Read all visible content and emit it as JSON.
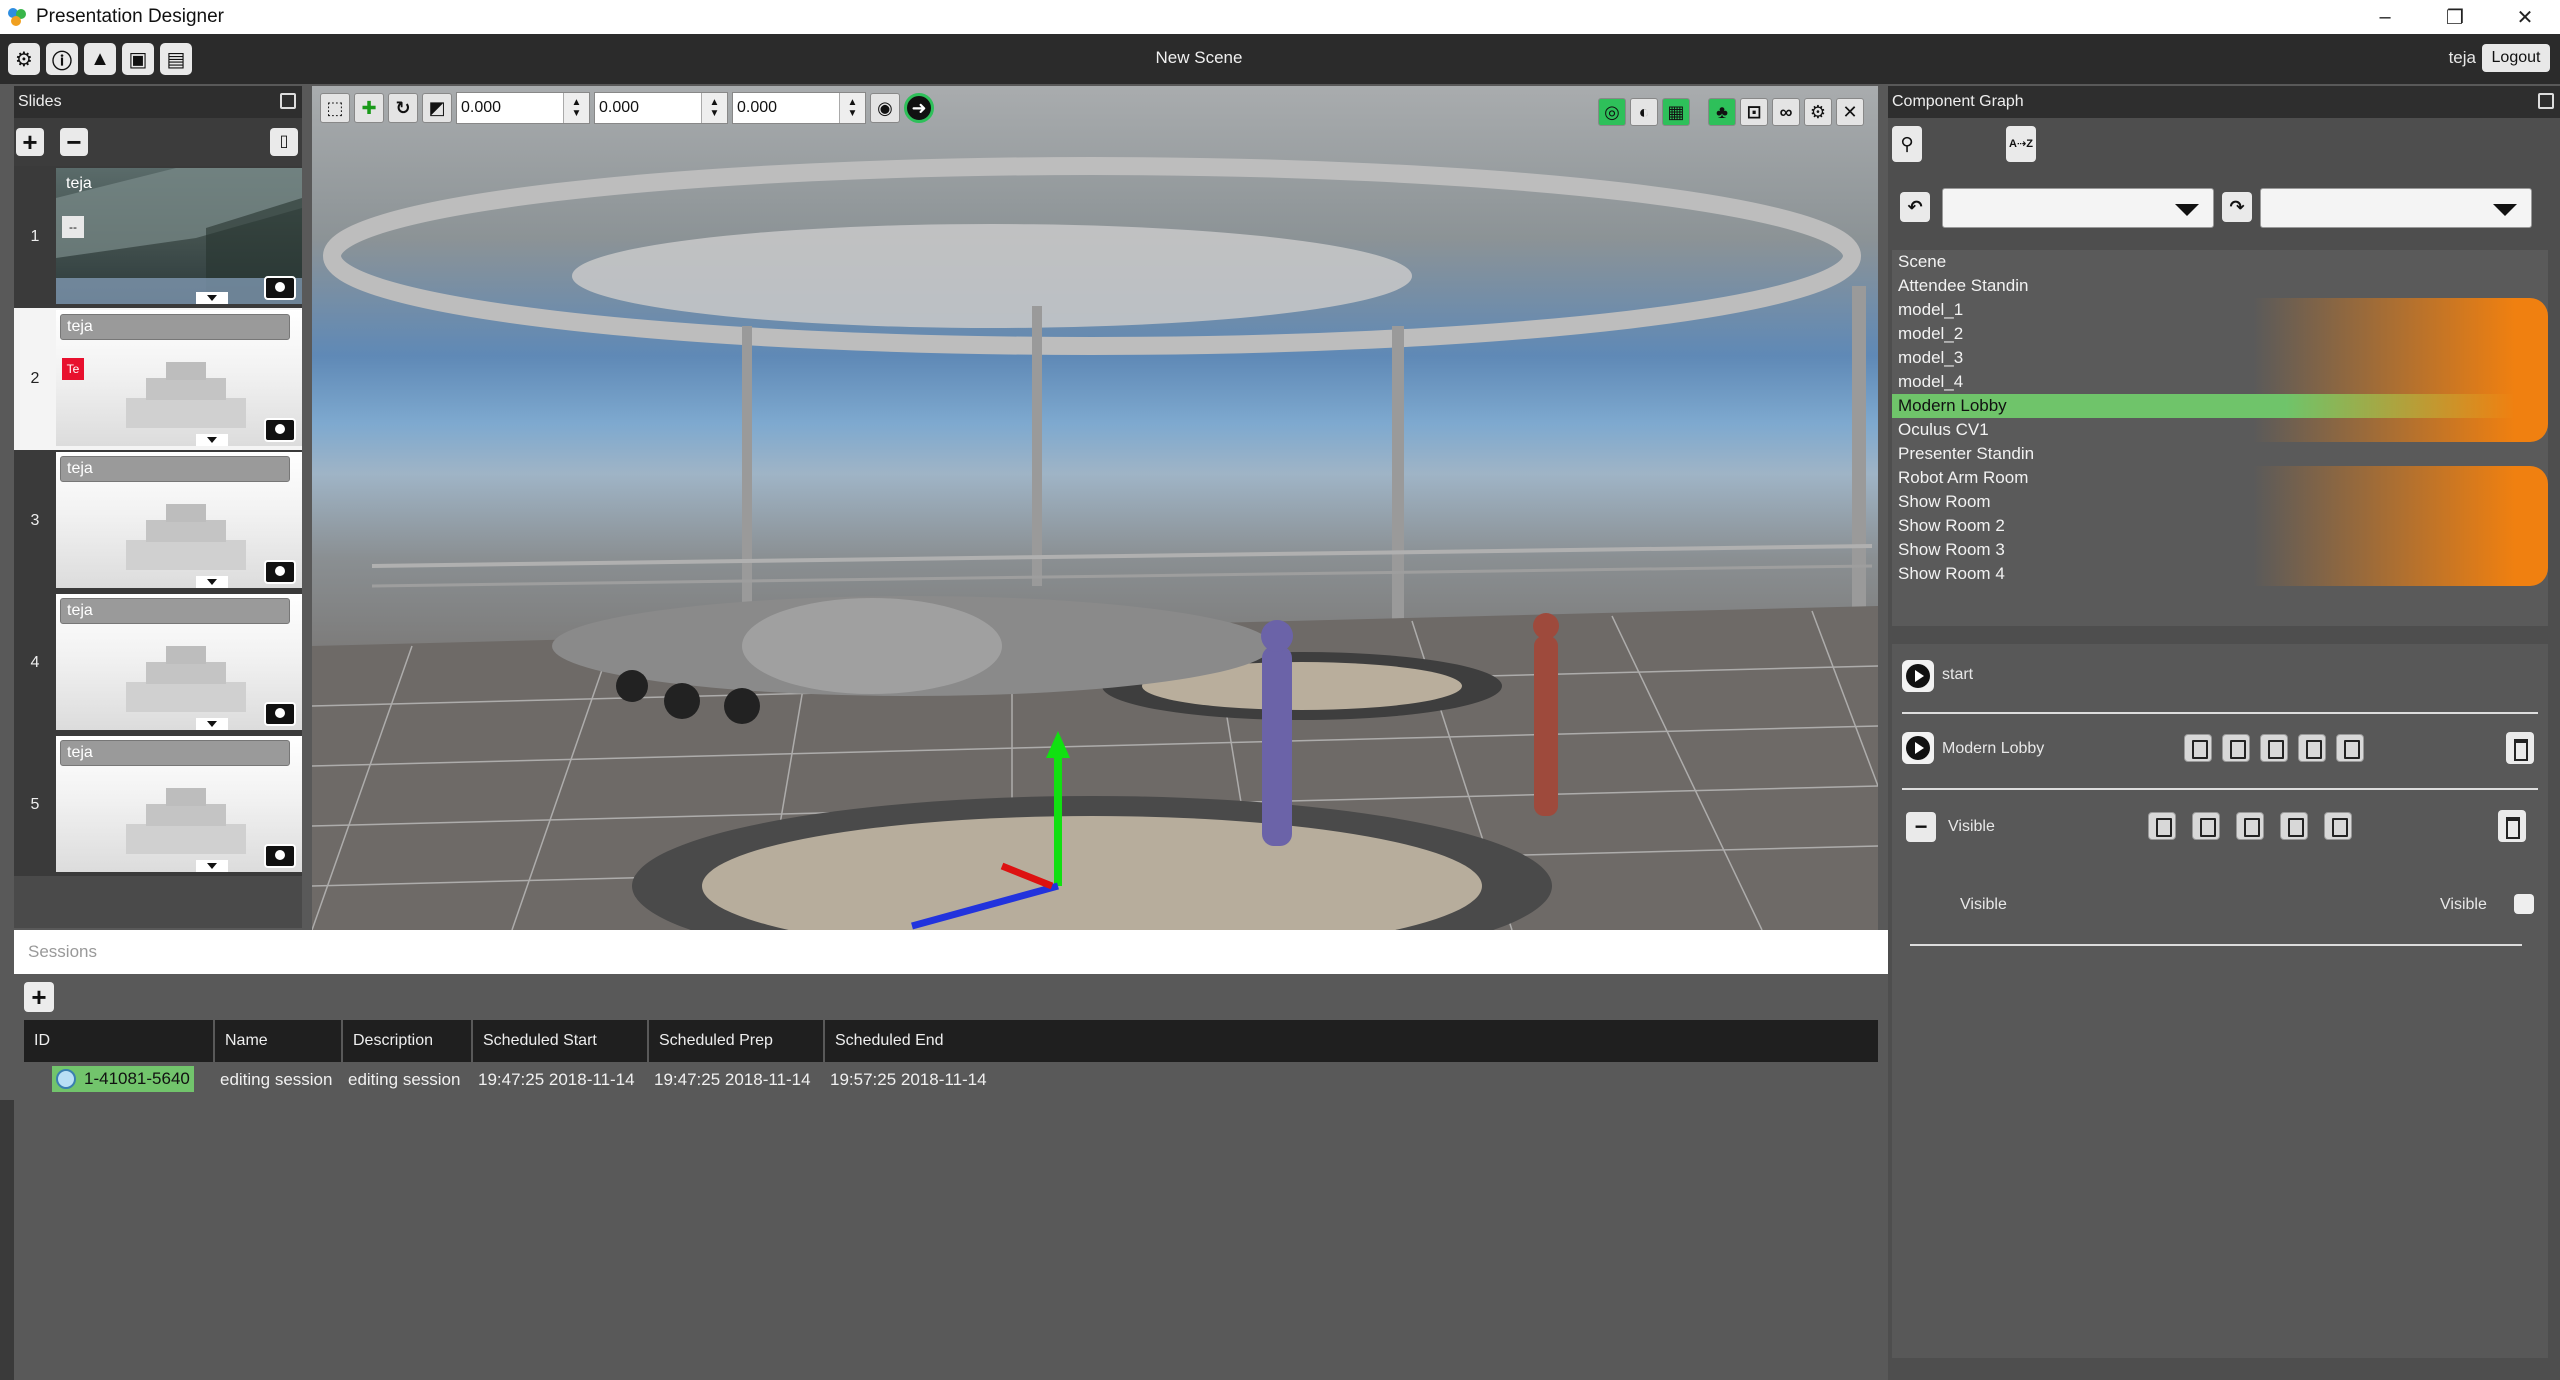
{
  "window": {
    "title": "Presentation Designer",
    "controls": [
      "–",
      "❐",
      "✕"
    ]
  },
  "toolbar": {
    "scene_title": "New Scene",
    "user": "teja",
    "logout_label": "Logout",
    "icons": [
      "gear-icon",
      "info-icon",
      "graduation-icon",
      "monitor-icon",
      "slides-icon"
    ]
  },
  "slides": {
    "title": "Slides",
    "add_label": "+",
    "remove_label": "−",
    "items": [
      {
        "number": "1",
        "name": "teja",
        "mark": "--"
      },
      {
        "number": "2",
        "name": "teja",
        "mark": "Te"
      },
      {
        "number": "3",
        "name": "teja"
      },
      {
        "number": "4",
        "name": "teja"
      },
      {
        "number": "5",
        "name": "teja"
      }
    ]
  },
  "viewport": {
    "x_value": "0.000",
    "y_value": "0.000",
    "z_value": "0.000"
  },
  "component_graph": {
    "title": "Component Graph",
    "sort_label": "A⇢Z",
    "items": [
      "Scene",
      "Attendee Standin",
      "model_1",
      "model_2",
      "model_3",
      "model_4",
      "Modern Lobby",
      "Oculus CV1",
      "Presenter Standin",
      "Robot Arm Room",
      "Show Room",
      "Show Room 2",
      "Show Room 3",
      "Show Room 4"
    ],
    "selected": "Modern Lobby",
    "detail": {
      "start_label": "start",
      "component_label": "Modern Lobby",
      "visible_group_label": "Visible",
      "visible_property_label": "Visible",
      "visible_toggle_label": "Visible",
      "collapse_label": "−"
    }
  },
  "sessions": {
    "title": "Sessions",
    "add_label": "+",
    "columns": [
      "ID",
      "Name",
      "Description",
      "Scheduled Start",
      "Scheduled Prep",
      "Scheduled End"
    ],
    "rows": [
      {
        "id": "1-41081-5640",
        "name": "editing session",
        "description": "editing session",
        "scheduled_start": "19:47:25 2018-11-14",
        "scheduled_prep": "19:47:25 2018-11-14",
        "scheduled_end": "19:57:25 2018-11-14"
      }
    ]
  },
  "colors": {
    "selected_green": "#6fc46a",
    "highlight_orange": "#f08010",
    "header_dark": "#1f1f1f"
  }
}
